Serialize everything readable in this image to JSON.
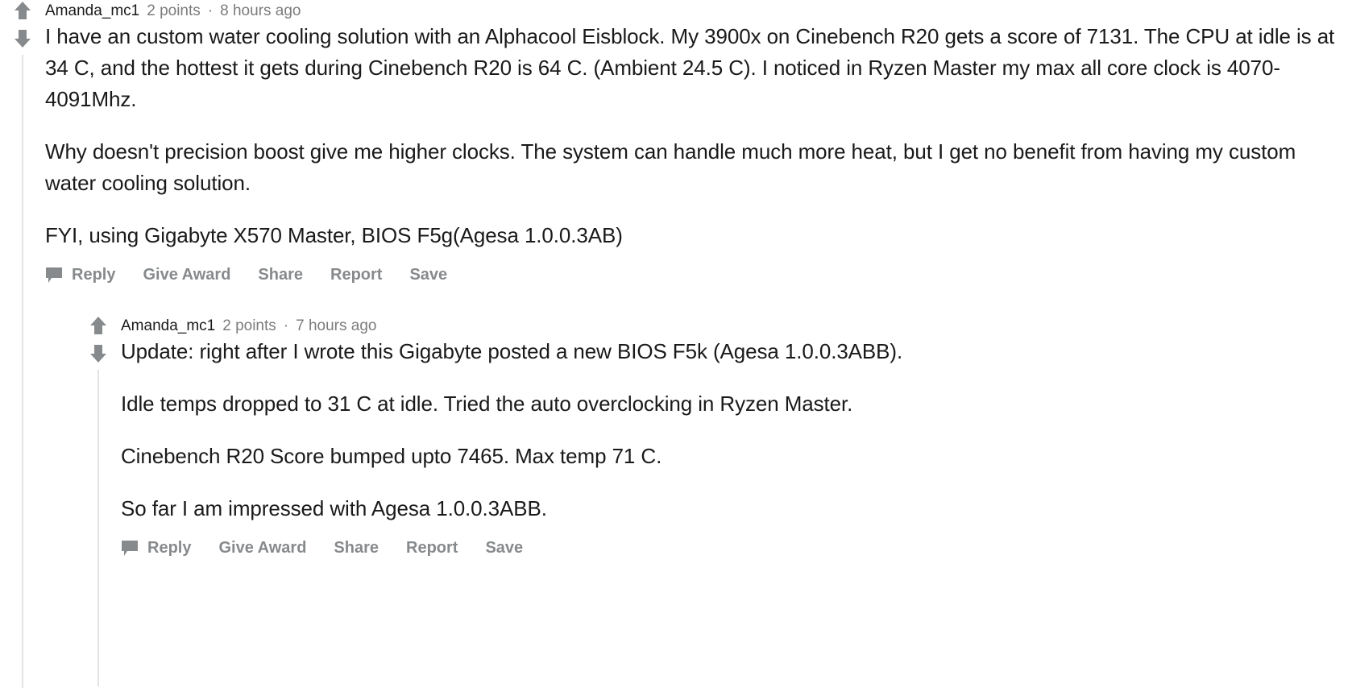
{
  "theme": {
    "text_color": "#1a1a1b",
    "meta_color": "#7c7c7c",
    "action_color": "#878a8c",
    "thread_line_color": "#e2e4e6",
    "background": "#ffffff"
  },
  "comments": [
    {
      "id": "comment-top",
      "author": "Amanda_mc1",
      "points": "2 points",
      "separator": "·",
      "timestamp": "8 hours ago",
      "upvote_icon": "upvote-arrow-icon",
      "downvote_icon": "downvote-arrow-icon",
      "paragraphs": [
        "I have an custom water cooling solution with an Alphacool Eisblock. My 3900x on Cinebench R20 gets a score of 7131. The CPU at idle is at 34 C, and the hottest it gets during Cinebench R20 is 64 C. (Ambient 24.5 C). I noticed in Ryzen Master my max all core clock is 4070-4091Mhz.",
        "Why doesn't precision boost give me higher clocks. The system can handle much more heat, but I get no benefit from having my custom water cooling solution.",
        "FYI, using Gigabyte X570 Master, BIOS F5g(Agesa 1.0.0.3AB)"
      ],
      "actions": {
        "reply_icon": "comment-bubble-icon",
        "reply": "Reply",
        "give_award": "Give Award",
        "share": "Share",
        "report": "Report",
        "save": "Save"
      }
    },
    {
      "id": "comment-reply",
      "author": "Amanda_mc1",
      "points": "2 points",
      "separator": "·",
      "timestamp": "7 hours ago",
      "upvote_icon": "upvote-arrow-icon",
      "downvote_icon": "downvote-arrow-icon",
      "paragraphs": [
        "Update: right after I wrote this Gigabyte posted a new BIOS F5k (Agesa 1.0.0.3ABB).",
        "Idle temps dropped to 31 C at idle. Tried the auto overclocking in Ryzen Master.",
        "Cinebench R20 Score bumped upto 7465. Max temp 71 C.",
        "So far I am impressed with Agesa 1.0.0.3ABB."
      ],
      "actions": {
        "reply_icon": "comment-bubble-icon",
        "reply": "Reply",
        "give_award": "Give Award",
        "share": "Share",
        "report": "Report",
        "save": "Save"
      }
    }
  ]
}
